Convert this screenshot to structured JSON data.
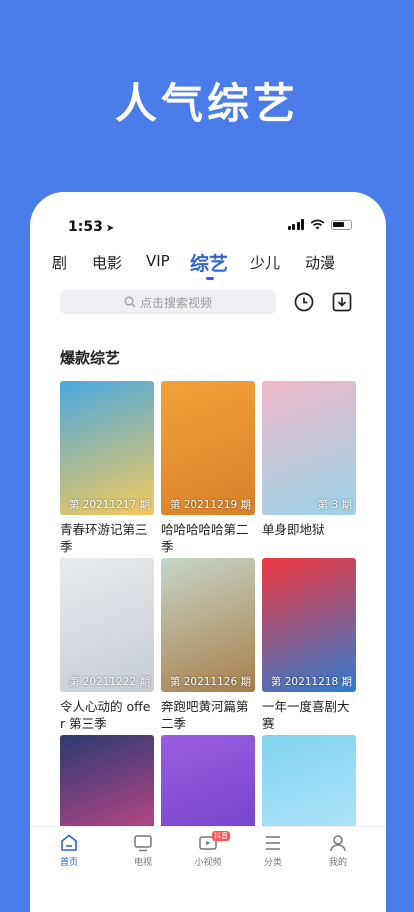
{
  "promo": {
    "title": "人气综艺"
  },
  "status_bar": {
    "time": "1:53"
  },
  "tabs": [
    "剧",
    "电影",
    "VIP",
    "综艺",
    "少儿",
    "动漫"
  ],
  "active_tab": "综艺",
  "search": {
    "placeholder": "点击搜索视频"
  },
  "section": {
    "title": "爆款综艺"
  },
  "cards": [
    {
      "title": "青春环游记第三季",
      "episode": "第 20211217 期",
      "colors": [
        "#4aa9e0",
        "#f5c95c"
      ]
    },
    {
      "title": "哈哈哈哈哈第二季",
      "episode": "第 20211219 期",
      "colors": [
        "#f2a23a",
        "#d8812a"
      ]
    },
    {
      "title": "单身即地狱",
      "episode": "第 3 期",
      "colors": [
        "#f0b8c8",
        "#9ad4ea"
      ]
    },
    {
      "title": "令人心动的 offer 第三季",
      "episode": "第 20211222 期",
      "colors": [
        "#e8ecef",
        "#c5ccd4"
      ]
    },
    {
      "title": "奔跑吧黄河篇第二季",
      "episode": "第 20211126 期",
      "colors": [
        "#c7d5c8",
        "#a87e4a"
      ]
    },
    {
      "title": "一年一度喜剧大赛",
      "episode": "第 20211218 期",
      "colors": [
        "#f0373e",
        "#2f7dd0"
      ]
    },
    {
      "title": "",
      "episode": "",
      "colors": [
        "#2c3a72",
        "#e04a8a"
      ]
    },
    {
      "title": "",
      "episode": "",
      "colors": [
        "#9b5de0",
        "#6b3dc8"
      ]
    },
    {
      "title": "",
      "episode": "",
      "colors": [
        "#7fd4f2",
        "#bde8f7"
      ]
    }
  ],
  "bottom_nav": [
    {
      "label": "首页",
      "icon": "home-icon",
      "active": true
    },
    {
      "label": "电视",
      "icon": "tv-icon",
      "active": false
    },
    {
      "label": "小视频",
      "icon": "short-video-icon",
      "active": false,
      "badge": "抖音"
    },
    {
      "label": "分类",
      "icon": "category-icon",
      "active": false
    },
    {
      "label": "我的",
      "icon": "profile-icon",
      "active": false
    }
  ],
  "accent_color": "#2f63d6",
  "background_color": "#4a7de9"
}
